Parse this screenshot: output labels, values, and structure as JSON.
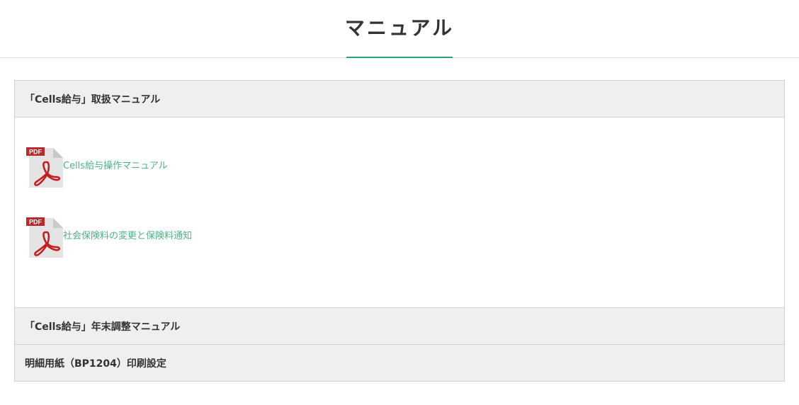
{
  "page": {
    "title": "マニュアル",
    "accent_color": "#2aa470",
    "link_color": "#4db386"
  },
  "sections": [
    {
      "title": "「Cells給与」取扱マニュアル",
      "expanded": true,
      "documents": [
        {
          "label": "Cells給与操作マニュアル",
          "icon": "pdf-icon",
          "icon_text": "PDF"
        },
        {
          "label": "社会保険料の変更と保険料通知",
          "icon": "pdf-icon",
          "icon_text": "PDF"
        }
      ]
    },
    {
      "title": "「Cells給与」年末調整マニュアル",
      "expanded": false
    },
    {
      "title": "明細用紙（BP1204）印刷設定",
      "expanded": false
    }
  ]
}
